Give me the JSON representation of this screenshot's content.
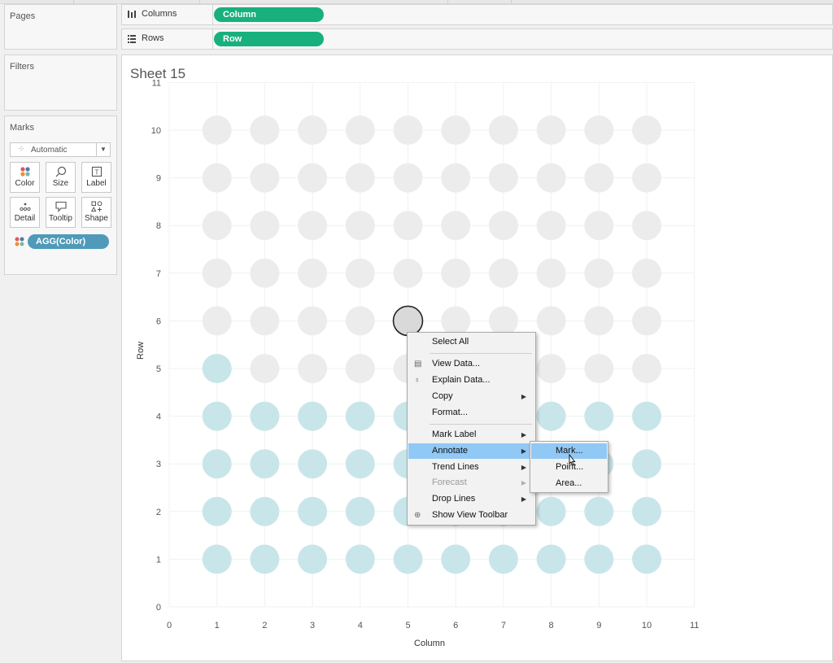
{
  "sidebar": {
    "pages_title": "Pages",
    "filters_title": "Filters",
    "marks_title": "Marks",
    "mark_type": "Automatic",
    "mark_buttons": [
      {
        "label": "Color",
        "icon": "color-icon"
      },
      {
        "label": "Size",
        "icon": "size-icon"
      },
      {
        "label": "Label",
        "icon": "label-icon"
      },
      {
        "label": "Detail",
        "icon": "detail-icon"
      },
      {
        "label": "Tooltip",
        "icon": "tooltip-icon"
      },
      {
        "label": "Shape",
        "icon": "shape-icon"
      }
    ],
    "color_pill": "AGG(Color)"
  },
  "shelves": {
    "columns_label": "Columns",
    "columns_pill": "Column",
    "rows_label": "Rows",
    "rows_pill": "Row"
  },
  "sheet": {
    "title": "Sheet 15"
  },
  "colors": {
    "accent_green": "#18b07c",
    "accent_blue": "#4f9ab8",
    "mark_gray": "#ececec",
    "mark_teal": "#c8e6ea",
    "selected_mark": "#d9d9d9",
    "menu_highlight": "#90c8f6"
  },
  "chart_data": {
    "type": "scatter",
    "xlabel": "Column",
    "ylabel": "Row",
    "xlim": [
      0,
      11
    ],
    "ylim": [
      0,
      11
    ],
    "x_ticks": [
      0,
      1,
      2,
      3,
      4,
      5,
      6,
      7,
      8,
      9,
      10,
      11
    ],
    "y_ticks": [
      0,
      1,
      2,
      3,
      4,
      5,
      6,
      7,
      8,
      9,
      10,
      11
    ],
    "grid": true,
    "columns": [
      1,
      2,
      3,
      4,
      5,
      6,
      7,
      8,
      9,
      10
    ],
    "rows": [
      1,
      2,
      3,
      4,
      5,
      6,
      7,
      8,
      9,
      10
    ],
    "teal_count_by_row": {
      "1": 10,
      "2": 10,
      "3": 10,
      "4": 10,
      "5": 1,
      "6": 0,
      "7": 0,
      "8": 0,
      "9": 0,
      "10": 0
    },
    "selected_point": {
      "x": 5,
      "y": 6
    }
  },
  "context_menu": {
    "items": [
      {
        "label": "Select All",
        "icon": "",
        "submenu": false,
        "disabled": false,
        "highlight": false,
        "sep_after": true
      },
      {
        "label": "View Data...",
        "icon": "view-data-icon",
        "submenu": false,
        "disabled": false,
        "highlight": false,
        "sep_after": false
      },
      {
        "label": "Explain Data...",
        "icon": "explain-data-icon",
        "submenu": false,
        "disabled": false,
        "highlight": false,
        "sep_after": false
      },
      {
        "label": "Copy",
        "icon": "",
        "submenu": true,
        "disabled": false,
        "highlight": false,
        "sep_after": false
      },
      {
        "label": "Format...",
        "icon": "",
        "submenu": false,
        "disabled": false,
        "highlight": false,
        "sep_after": true
      },
      {
        "label": "Mark Label",
        "icon": "",
        "submenu": true,
        "disabled": false,
        "highlight": false,
        "sep_after": false
      },
      {
        "label": "Annotate",
        "icon": "",
        "submenu": true,
        "disabled": false,
        "highlight": true,
        "sep_after": false
      },
      {
        "label": "Trend Lines",
        "icon": "",
        "submenu": true,
        "disabled": false,
        "highlight": false,
        "sep_after": false
      },
      {
        "label": "Forecast",
        "icon": "",
        "submenu": true,
        "disabled": true,
        "highlight": false,
        "sep_after": false
      },
      {
        "label": "Drop Lines",
        "icon": "",
        "submenu": true,
        "disabled": false,
        "highlight": false,
        "sep_after": false
      },
      {
        "label": "Show View Toolbar",
        "icon": "zoom-icon",
        "submenu": false,
        "disabled": false,
        "highlight": false,
        "sep_after": false
      }
    ]
  },
  "annotate_submenu": {
    "items": [
      {
        "label": "Mark...",
        "highlight": true
      },
      {
        "label": "Point...",
        "highlight": false
      },
      {
        "label": "Area...",
        "highlight": false
      }
    ]
  }
}
